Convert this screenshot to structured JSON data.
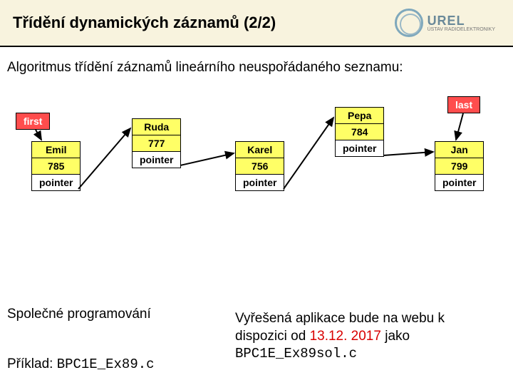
{
  "header": {
    "title": "Třídění dynamických záznamů (2/2)",
    "logo_name": "UREL",
    "logo_sub": "ÚSTAV RADIOELEKTRONIKY"
  },
  "algo": "Algoritmus třídění záznamů lineárního neuspořádaného seznamu:",
  "tags": {
    "first": "first",
    "last": "last"
  },
  "nodes": {
    "n0": {
      "name": "Emil",
      "num": "785",
      "ptr": "pointer"
    },
    "n1": {
      "name": "Ruda",
      "num": "777",
      "ptr": "pointer"
    },
    "n2": {
      "name": "Karel",
      "num": "756",
      "ptr": "pointer"
    },
    "n3": {
      "name": "Pepa",
      "num": "784",
      "ptr": "pointer"
    },
    "n4": {
      "name": "Jan",
      "num": "799",
      "ptr": "pointer"
    }
  },
  "prog_label": "Společné programování",
  "example_label": "Příklad: ",
  "example_file": "BPC1E_Ex89.c",
  "solved_pre": "Vyřešená aplikace bude na webu k dispozici od ",
  "solved_date": "13.12. 2017",
  "solved_post": " jako ",
  "solved_file": "BPC1E_Ex89sol.c"
}
